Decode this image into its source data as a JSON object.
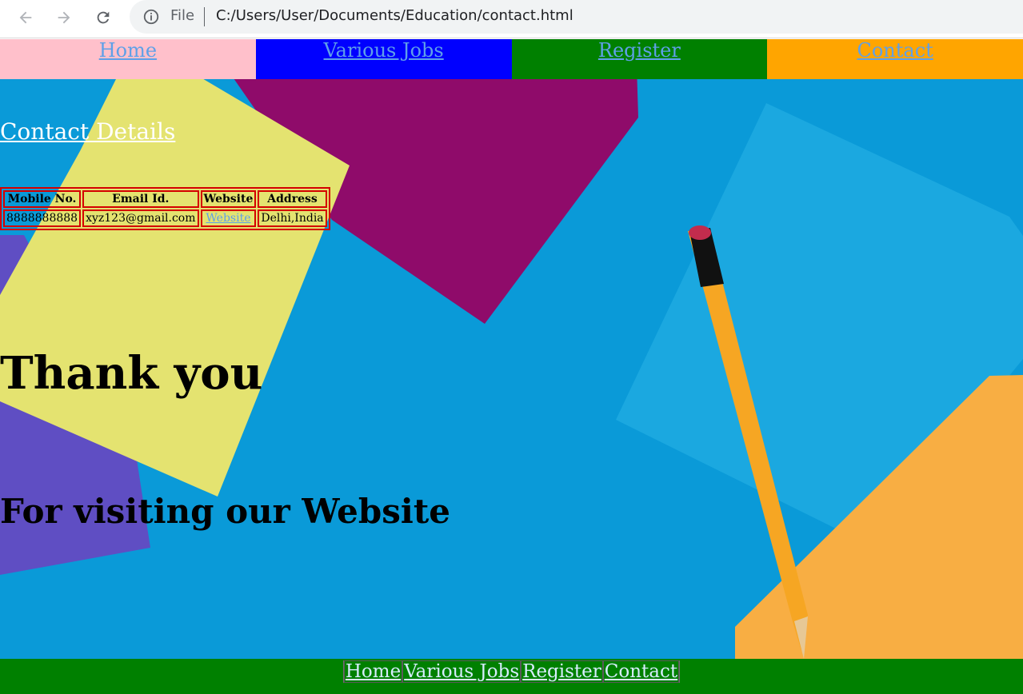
{
  "browser": {
    "scheme_label": "File",
    "url": "C:/Users/User/Documents/Education/contact.html"
  },
  "nav": {
    "items": [
      {
        "label": "Home",
        "color": "#ffc0cb"
      },
      {
        "label": "Various Jobs",
        "color": "#0000ff"
      },
      {
        "label": "Register",
        "color": "#008000"
      },
      {
        "label": "Contact",
        "color": "#ffa500"
      }
    ]
  },
  "contact": {
    "heading": "Contact Details",
    "table": {
      "headers": [
        "Mobile No.",
        "Email Id.",
        "Website",
        "Address"
      ],
      "row": {
        "mobile": "8888888888",
        "email": "xyz123@gmail.com",
        "website": "Website",
        "address": "Delhi,India"
      }
    }
  },
  "thanks_heading": "Thank you",
  "visit_heading": "For visiting our Website",
  "footer": {
    "links": [
      "Home",
      "Various Jobs",
      "Register",
      "Contact"
    ]
  },
  "colors": {
    "background": "#0a9ad8",
    "table_border": "#d40000",
    "link": "#5fa0e8",
    "footer_bg": "#008000"
  }
}
